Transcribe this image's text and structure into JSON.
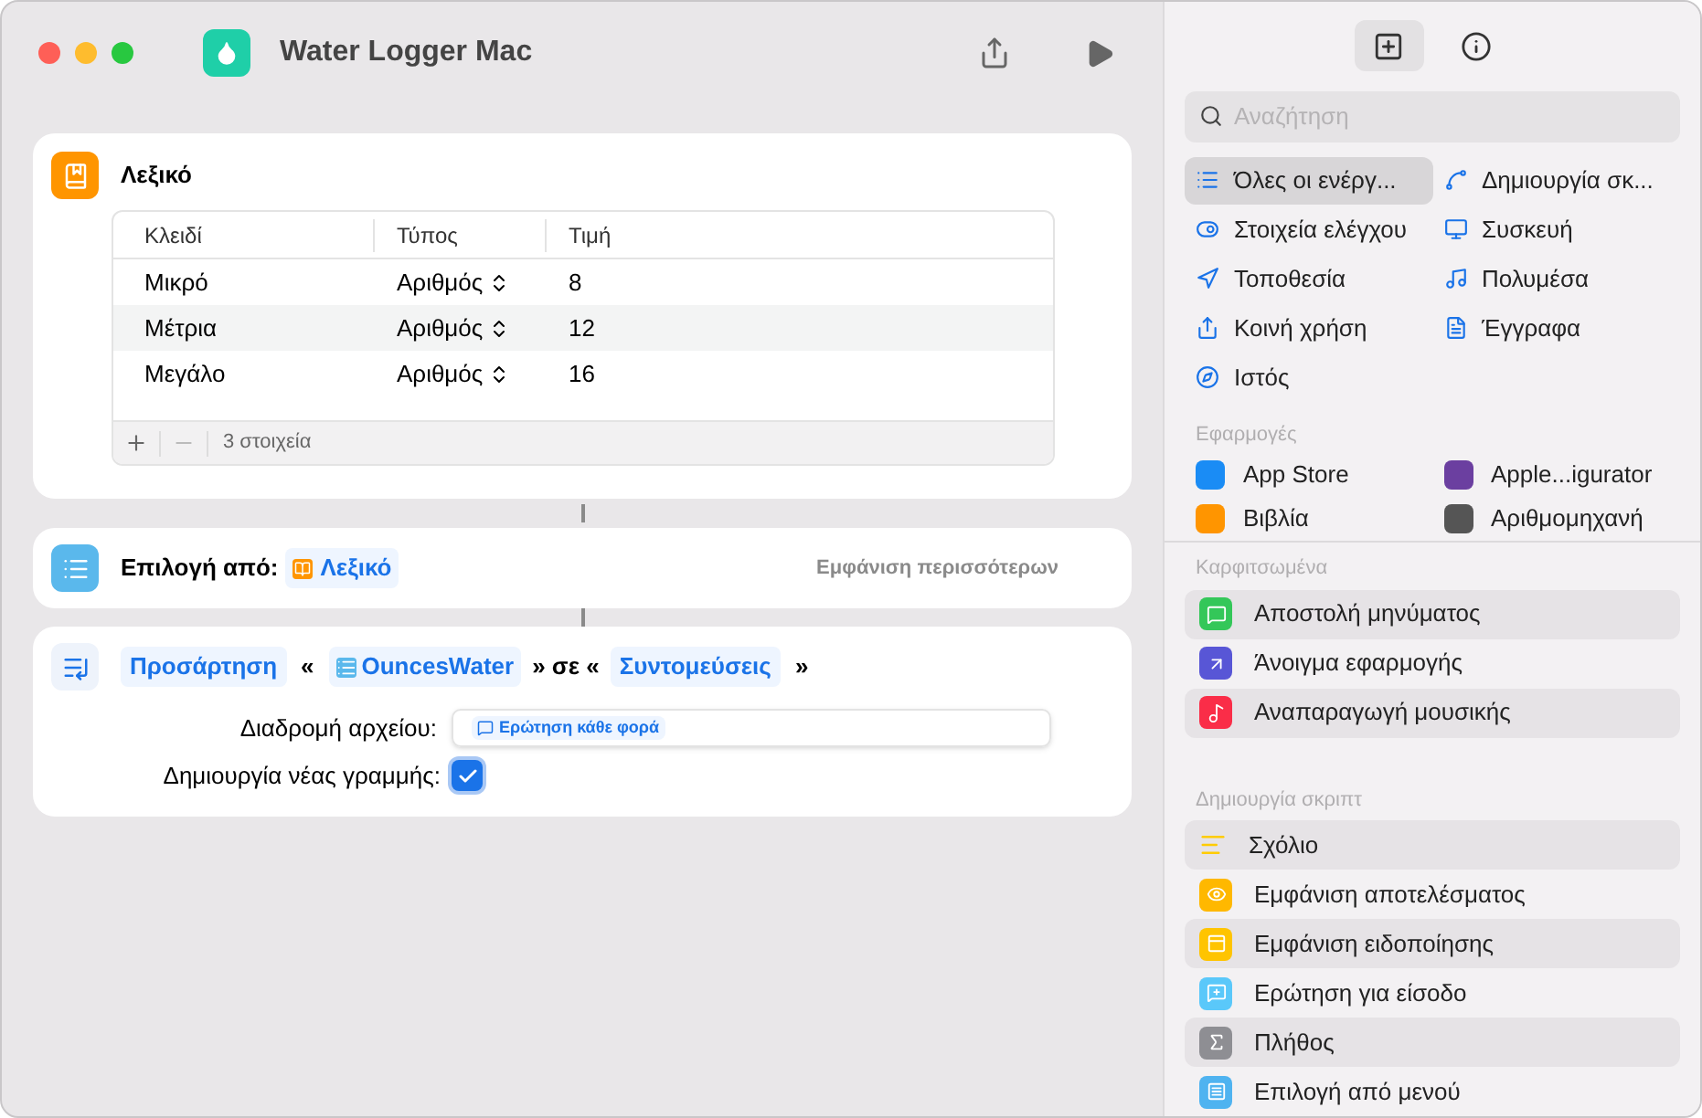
{
  "window": {
    "title": "Water Logger Mac"
  },
  "dictionary": {
    "title": "Λεξικό",
    "columns": [
      "Κλειδί",
      "Τύπος",
      "Τιμή"
    ],
    "rows": [
      {
        "key": "Μικρό",
        "type": "Αριθμός",
        "value": "8"
      },
      {
        "key": "Μέτρια",
        "type": "Αριθμός",
        "value": "12"
      },
      {
        "key": "Μεγάλο",
        "type": "Αριθμός",
        "value": "16"
      }
    ],
    "count": "3 στοιχεία"
  },
  "choose": {
    "label": "Επιλογή από:",
    "token": "Λεξικό",
    "more": "Εμφάνιση περισσότερων"
  },
  "append": {
    "verb": "Προσάρτηση",
    "quote_open": "«",
    "variable": "OuncesWater",
    "middle": "» σε «",
    "target": "Συντομεύσεις",
    "quote_close": "»",
    "path_label": "Διαδρομή αρχείου:",
    "path_token": "Ερώτηση κάθε φορά",
    "newline_label": "Δημιουργία νέας γραμμής:",
    "newline_checked": true
  },
  "panel_tabs": [
    {
      "kind": "library",
      "selected": true
    },
    {
      "kind": "info",
      "selected": false
    }
  ],
  "search": {
    "placeholder": "Αναζήτηση"
  },
  "categories": [
    {
      "label": "Όλες οι ενέργ...",
      "selected": true
    },
    {
      "label": "Δημιουργία σκ...",
      "selected": false
    },
    {
      "label": "Στοιχεία ελέγχου",
      "selected": false
    },
    {
      "label": "Συσκευή",
      "selected": false
    },
    {
      "label": "Τοποθεσία",
      "selected": false
    },
    {
      "label": "Πολυμέσα",
      "selected": false
    },
    {
      "label": "Κοινή χρήση",
      "selected": false
    },
    {
      "label": "Έγγραφα",
      "selected": false
    },
    {
      "label": "Ιστός",
      "selected": false
    }
  ],
  "apps": {
    "heading": "Εφαρμογές",
    "items": [
      {
        "label": "App Store",
        "color": "#1a8cf5"
      },
      {
        "label": "Apple...igurator",
        "color": "#6b3fa0"
      },
      {
        "label": "Βιβλία",
        "color": "#ff9500"
      },
      {
        "label": "Αριθμομηχανή",
        "color": "#555555"
      }
    ]
  },
  "pinned": {
    "heading": "Καρφιτσωμένα",
    "items": [
      {
        "label": "Αποστολή μηνύματος",
        "color": "#34c759"
      },
      {
        "label": "Άνοιγμα εφαρμογής",
        "color": "#5856d6"
      },
      {
        "label": "Αναπαραγωγή μουσικής",
        "color": "#fa2d48"
      }
    ]
  },
  "scripting": {
    "heading": "Δημιουργία σκριπτ",
    "items": [
      {
        "label": "Σχόλιο",
        "color": "#ffcc00"
      },
      {
        "label": "Εμφάνιση αποτελέσματος",
        "color": "#ffb800"
      },
      {
        "label": "Εμφάνιση ειδοποίησης",
        "color": "#ffc400"
      },
      {
        "label": "Ερώτηση για είσοδο",
        "color": "#5ac8fa"
      },
      {
        "label": "Πλήθος",
        "color": "#8e8e93"
      },
      {
        "label": "Επιλογή από μενού",
        "color": "#4fb3f0"
      }
    ]
  }
}
